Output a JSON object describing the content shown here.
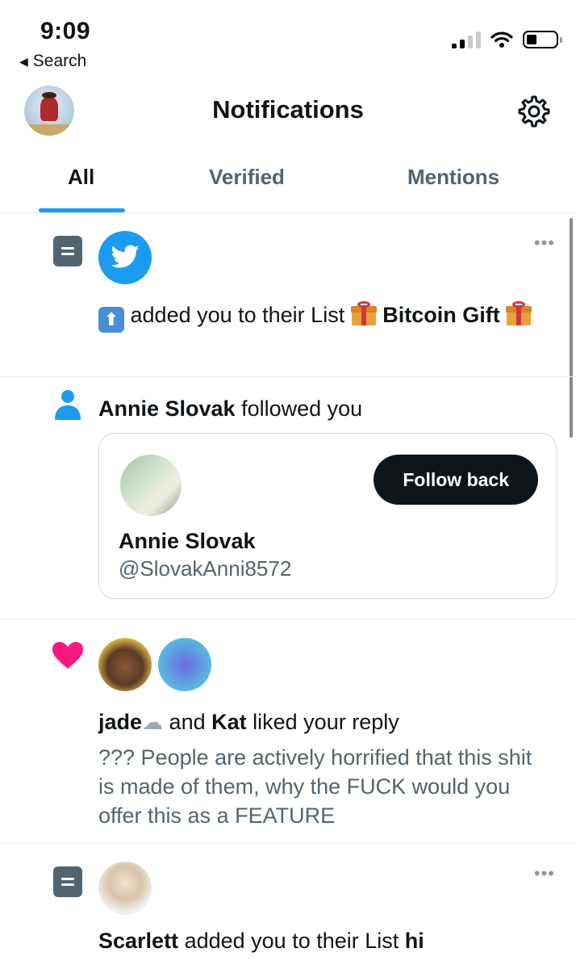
{
  "status": {
    "time": "9:09",
    "back_label": "Search"
  },
  "header": {
    "title": "Notifications"
  },
  "tabs": [
    {
      "label": "All",
      "active": true
    },
    {
      "label": "Verified",
      "active": false
    },
    {
      "label": "Mentions",
      "active": false
    }
  ],
  "notifications": {
    "list_add_1": {
      "prefix": "added you to their List",
      "list_name": "Bitcoin Gift",
      "icon": "list-icon"
    },
    "follow": {
      "name": "Annie Slovak",
      "action": "followed you",
      "card_name": "Annie Slovak",
      "card_handle": "@SlovakAnni8572",
      "button_label": "Follow back"
    },
    "like": {
      "user1": "jade",
      "connector": "and",
      "user2": "Kat",
      "action": "liked your reply",
      "reply_text": "??? People are actively horrified that this shit is made of them, why the FUCK would you offer this as a FEATURE"
    },
    "list_add_2": {
      "name": "Scarlett",
      "action": "added you to their List",
      "list_name": "hi"
    }
  },
  "colors": {
    "accent": "#1d9bf0",
    "heart": "#f91880",
    "muted_text": "#536471",
    "button_bg": "#0f1419"
  }
}
